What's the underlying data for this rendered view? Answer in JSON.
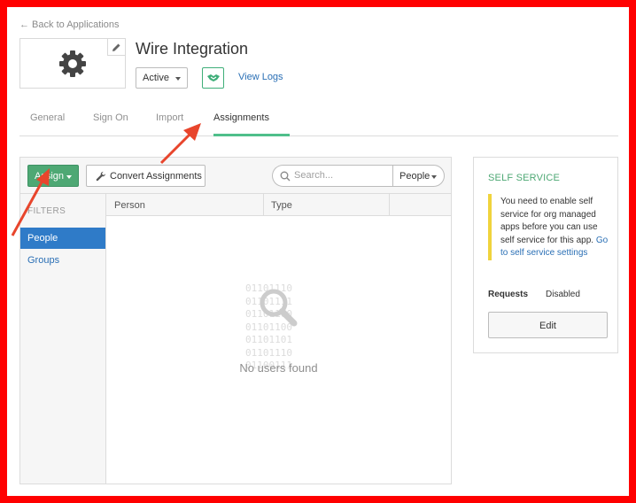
{
  "nav": {
    "back_label": "← Back to Applications"
  },
  "app": {
    "title": "Wire Integration",
    "status": "Active",
    "view_logs": "View Logs"
  },
  "tabs": [
    {
      "label": "General"
    },
    {
      "label": "Sign On"
    },
    {
      "label": "Import"
    },
    {
      "label": "Assignments",
      "active": true
    }
  ],
  "toolbar": {
    "assign_label": "Assign",
    "convert_label": "Convert Assignments",
    "search_placeholder": "Search...",
    "search_scope": "People"
  },
  "filters": {
    "title": "FILTERS",
    "items": [
      {
        "label": "People",
        "active": true
      },
      {
        "label": "Groups"
      }
    ]
  },
  "table": {
    "columns": [
      "Person",
      "Type"
    ],
    "empty_text": "No users found",
    "empty_art": "01101110\n01101111\n01101100\n01101100\n01101101\n01101110\n01100111"
  },
  "self_service": {
    "title": "SELF SERVICE",
    "message": "You need to enable self service for org managed apps before you can use self service for this app.",
    "link": "Go to self service settings",
    "requests_label": "Requests",
    "requests_value": "Disabled",
    "edit_label": "Edit"
  },
  "icons": {
    "app_logo": "gear-icon",
    "edit_logo": "pencil-icon",
    "handshake": "handshake-icon",
    "convert": "wrench-icon",
    "search": "search-icon",
    "empty_state": "magnifier-icon"
  },
  "colors": {
    "frame": "#ff0000",
    "accent_green": "#4ea874",
    "link_blue": "#2a6fb5",
    "active_filter": "#2f7bc8",
    "note_bar": "#f0d33c",
    "annotation_arrow": "#e8452c"
  }
}
